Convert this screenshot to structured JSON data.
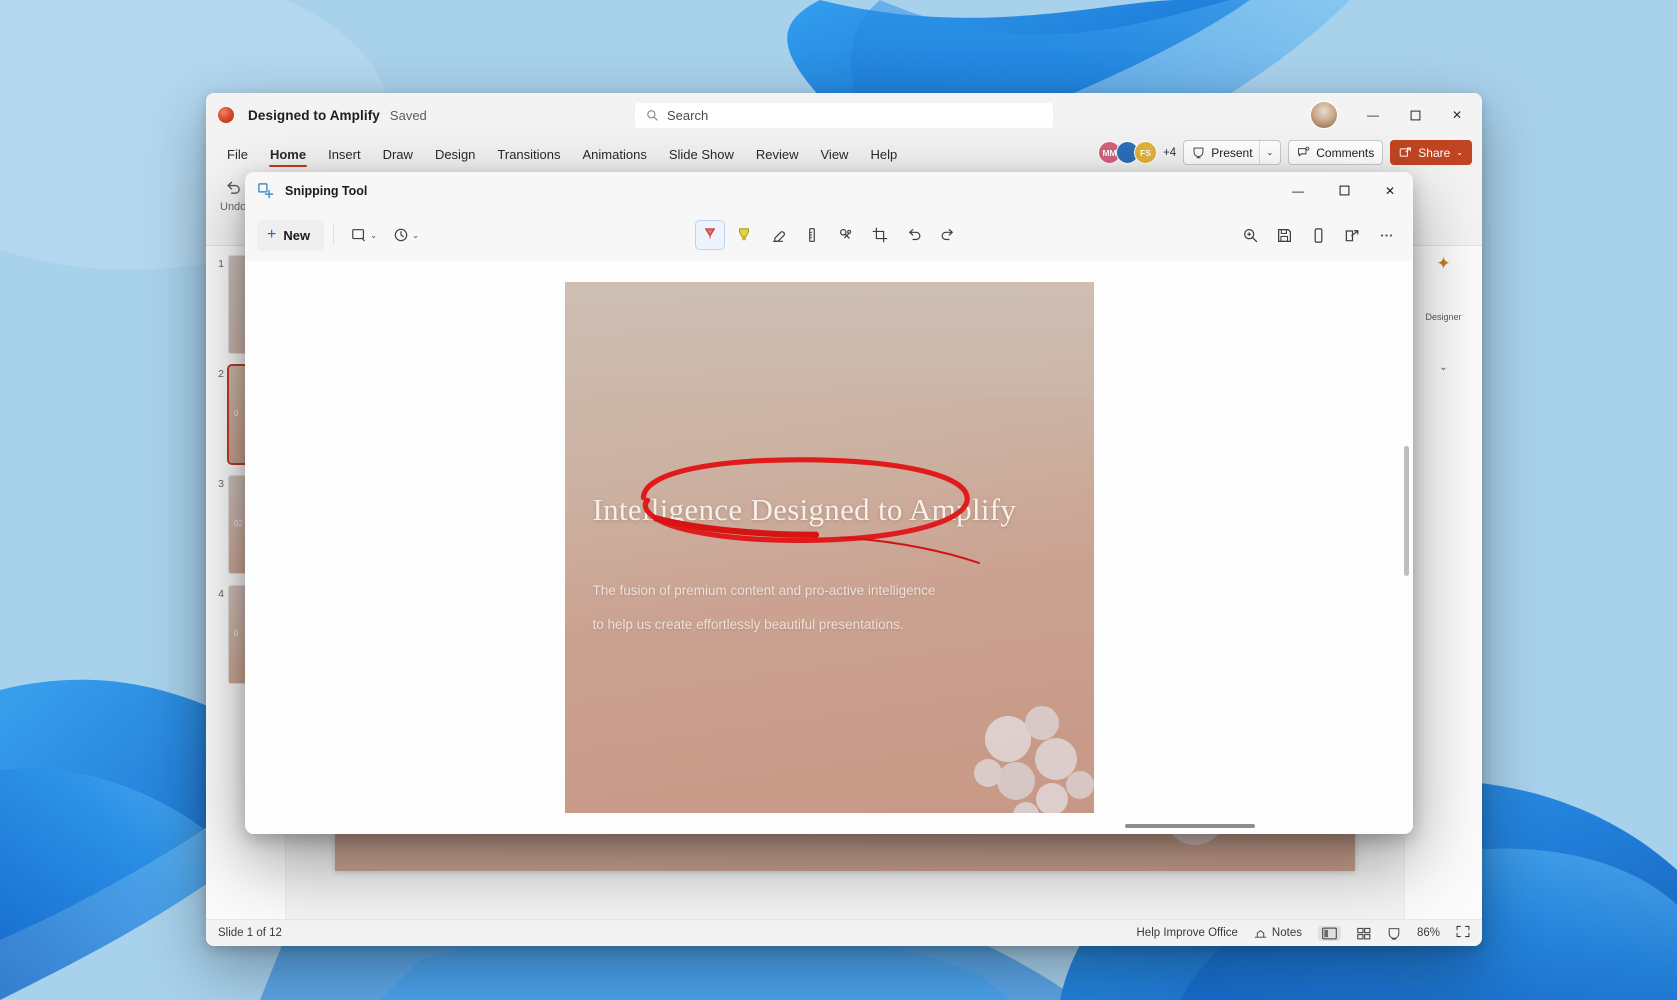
{
  "powerpoint": {
    "app_icon": "powerpoint-icon",
    "document_name": "Designed to Amplify",
    "save_state": "Saved",
    "search": {
      "placeholder": "Search",
      "value": "",
      "icon": "search-icon"
    },
    "window_controls": {
      "minimize": "—",
      "maximize": "☐",
      "close": "✕"
    },
    "avatar": "user-avatar",
    "ribbon_tabs": [
      {
        "label": "File",
        "active": false
      },
      {
        "label": "Home",
        "active": true
      },
      {
        "label": "Insert",
        "active": false
      },
      {
        "label": "Draw",
        "active": false
      },
      {
        "label": "Design",
        "active": false
      },
      {
        "label": "Transitions",
        "active": false
      },
      {
        "label": "Animations",
        "active": false
      },
      {
        "label": "Slide Show",
        "active": false
      },
      {
        "label": "Review",
        "active": false
      },
      {
        "label": "View",
        "active": false
      },
      {
        "label": "Help",
        "active": false
      }
    ],
    "presence": {
      "chips": [
        {
          "initials": "MM",
          "color": "#d4627e"
        },
        {
          "initials": "",
          "color": "#2c6fbb"
        },
        {
          "initials": "FS",
          "color": "#e2b33c"
        }
      ],
      "overflow": "+4"
    },
    "present_button": {
      "label": "Present",
      "icon": "present-icon",
      "caret": "⌄"
    },
    "comments_button": {
      "label": "Comments",
      "icon": "comment-icon"
    },
    "share_button": {
      "label": "Share",
      "icon": "share-icon",
      "caret": "⌄",
      "color": "#c04522"
    },
    "ribbon_commands": [
      {
        "label": "Undo",
        "icon": "undo-icon"
      },
      {
        "label": "",
        "icon": "clipboard-icon"
      }
    ],
    "thumbnails": [
      {
        "number": "1",
        "selected": false,
        "label": ""
      },
      {
        "number": "2",
        "selected": true,
        "label": "0"
      },
      {
        "number": "3",
        "selected": false,
        "label": "02"
      },
      {
        "number": "4",
        "selected": false,
        "label": "0"
      }
    ],
    "designer_pane": {
      "icon": "designer-wand-icon",
      "label_top": "Designer",
      "label_bottom": "Designer",
      "caret": "⌄"
    },
    "status_bar": {
      "slide_counter": "Slide 1 of 12",
      "help_improve": "Help Improve Office",
      "notes": "Notes",
      "notes_icon": "notes-icon",
      "views": [
        {
          "name": "normal-view",
          "icon": "normal-view-icon",
          "active": true
        },
        {
          "name": "slide-sorter-view",
          "icon": "grid-view-icon",
          "active": false
        },
        {
          "name": "reading-view",
          "icon": "reading-view-icon",
          "active": false
        }
      ],
      "zoom": "86%",
      "fit_icon": "fit-to-window-icon"
    }
  },
  "snipping_tool": {
    "title": "Snipping Tool",
    "title_icon": "snipping-tool-icon",
    "window_controls": {
      "minimize": "—",
      "maximize": "☐",
      "close": "✕"
    },
    "new_button": {
      "label": "New",
      "plus": "+"
    },
    "mode_dropdown": {
      "icon": "rectangle-mode-icon",
      "caret": "⌄"
    },
    "delay_dropdown": {
      "icon": "timer-delay-icon",
      "caret": "⌄"
    },
    "tools": [
      {
        "name": "ballpoint-pen-tool",
        "icon": "ballpoint-pen-icon",
        "selected": true,
        "color": "#d63434"
      },
      {
        "name": "highlighter-tool",
        "icon": "highlighter-icon",
        "selected": false,
        "color": "#e8d23a"
      },
      {
        "name": "eraser-tool",
        "icon": "eraser-icon",
        "selected": false
      },
      {
        "name": "ruler-tool",
        "icon": "ruler-icon",
        "selected": false
      },
      {
        "name": "touch-writing-tool",
        "icon": "touch-writing-icon",
        "selected": false
      },
      {
        "name": "crop-tool",
        "icon": "crop-icon",
        "selected": false
      },
      {
        "name": "undo-button",
        "icon": "undo-icon",
        "selected": false
      },
      {
        "name": "redo-button",
        "icon": "redo-icon",
        "selected": false
      }
    ],
    "right_tools": [
      {
        "name": "zoom-button",
        "icon": "magnifier-plus-icon"
      },
      {
        "name": "save-button",
        "icon": "save-disk-icon"
      },
      {
        "name": "copy-button",
        "icon": "phone-copy-icon"
      },
      {
        "name": "share-button",
        "icon": "share-arrow-icon"
      },
      {
        "name": "more-options-button",
        "icon": "ellipsis-icon"
      }
    ],
    "captured_slide": {
      "title": "Intelligence Designed to Amplify",
      "subtitle_line1": "The fusion of premium content and pro-active intelligence",
      "subtitle_line2": "to help us create effortlessly beautiful presentations.",
      "annotation": {
        "type": "red-ink-ellipse",
        "color": "#e01b1b"
      }
    }
  }
}
